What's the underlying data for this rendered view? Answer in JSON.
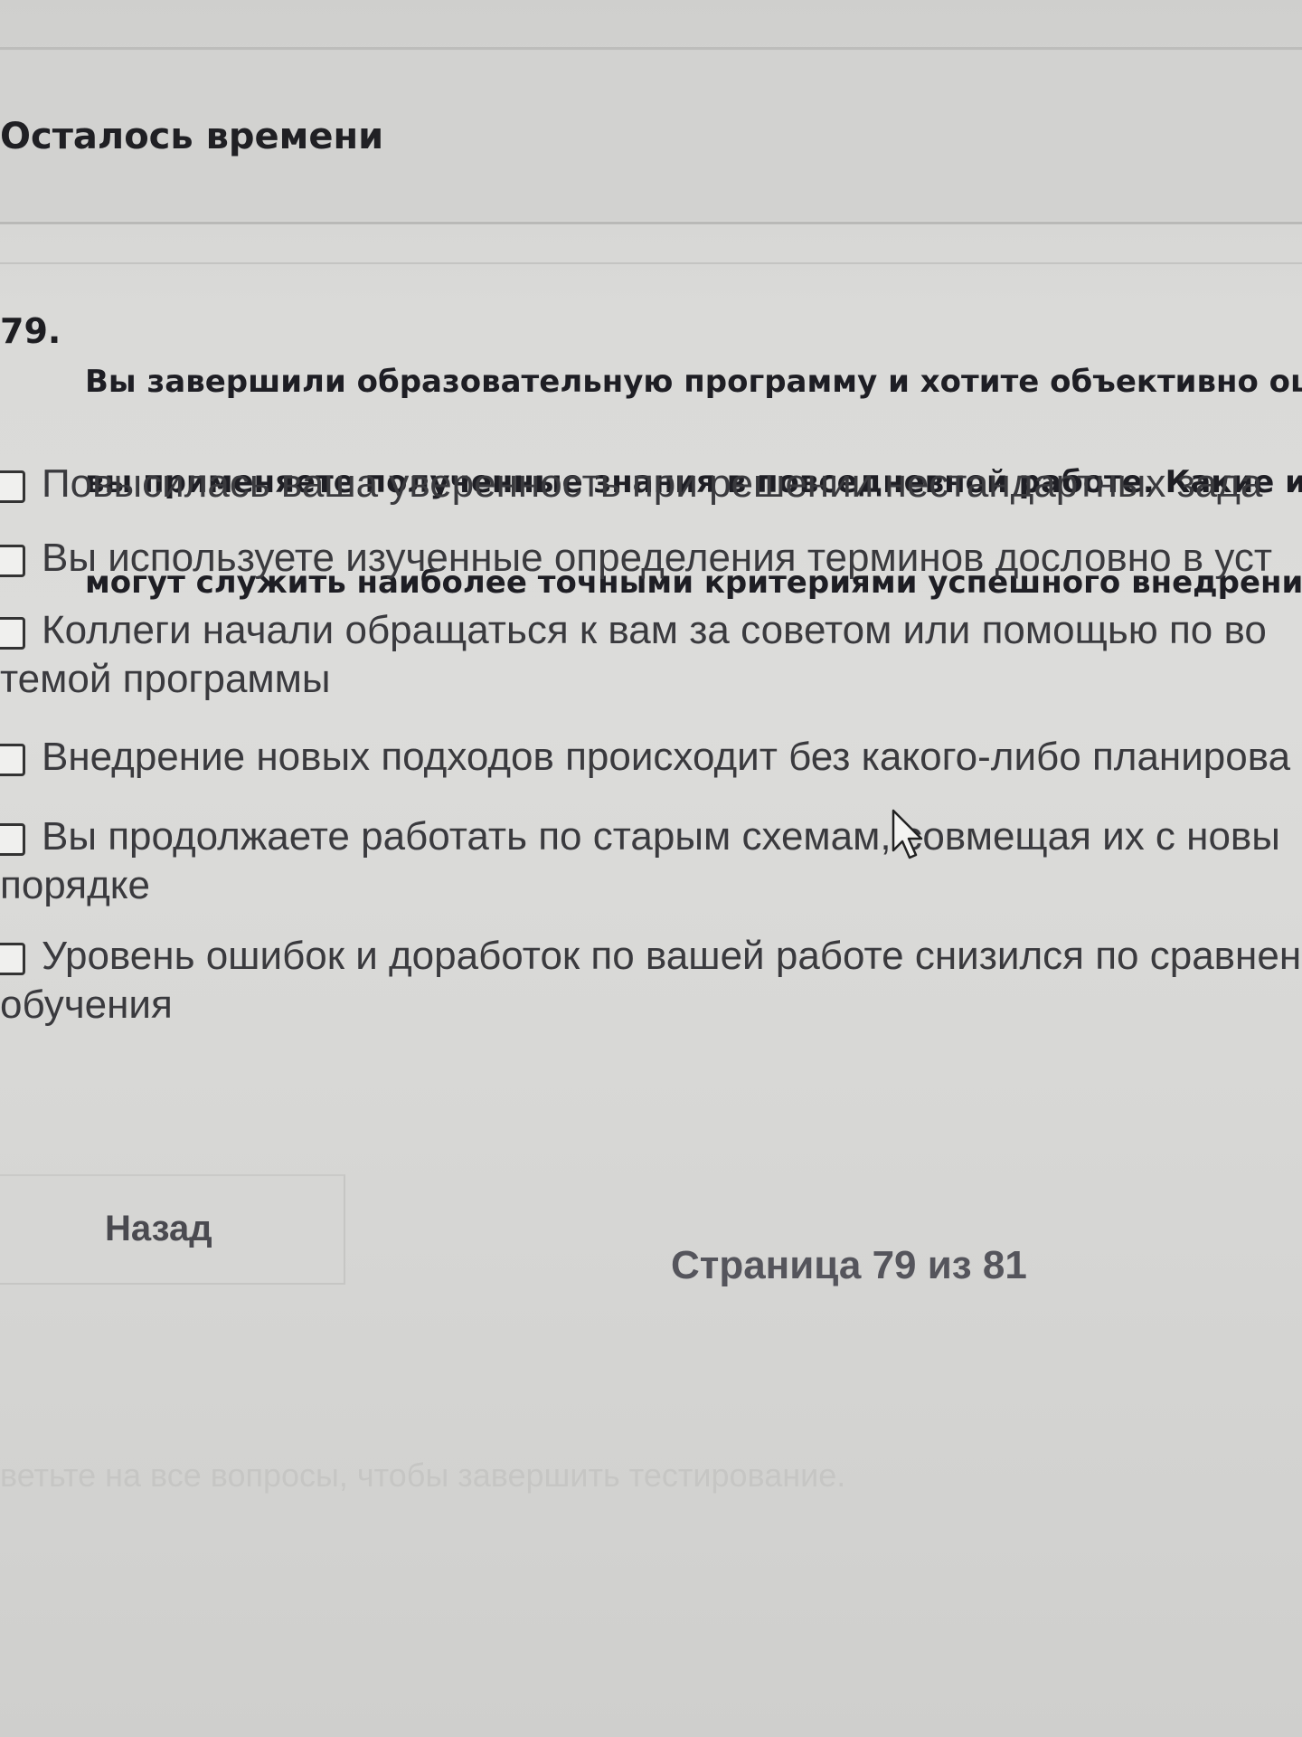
{
  "timer": {
    "label": "Осталось времени"
  },
  "question": {
    "number": "79.",
    "text_lines": [
      "Вы завершили образовательную программу и хотите объективно оцен",
      "вы применяете полученные знания в повседневной работе. Какие из с",
      "могут служить наиболее точными критериями успешного внедрения и"
    ]
  },
  "options": [
    {
      "line1": "Повысилась ваша уверенность при решении нестандартных зада",
      "line2": ""
    },
    {
      "line1": "Вы используете изученные определения терминов дословно в уст",
      "line2": ""
    },
    {
      "line1": "Коллеги начали обращаться к вам за советом или помощью по во",
      "line2": "темой программы"
    },
    {
      "line1": "Внедрение новых подходов происходит без какого-либо планирова",
      "line2": ""
    },
    {
      "line1": "Вы продолжаете работать по старым схемам, совмещая их с новы",
      "line2": "порядке"
    },
    {
      "line1": "Уровень ошибок и доработок по вашей работе снизился по сравнен",
      "line2": "обучения"
    }
  ],
  "footer": {
    "back_label": "Назад",
    "page_indicator": "Страница 79 из 81",
    "hint": "ветьте на все вопросы, чтобы завершить тестирование."
  },
  "icons": {
    "checkbox": "checkbox-icon",
    "cursor": "mouse-pointer-icon"
  }
}
